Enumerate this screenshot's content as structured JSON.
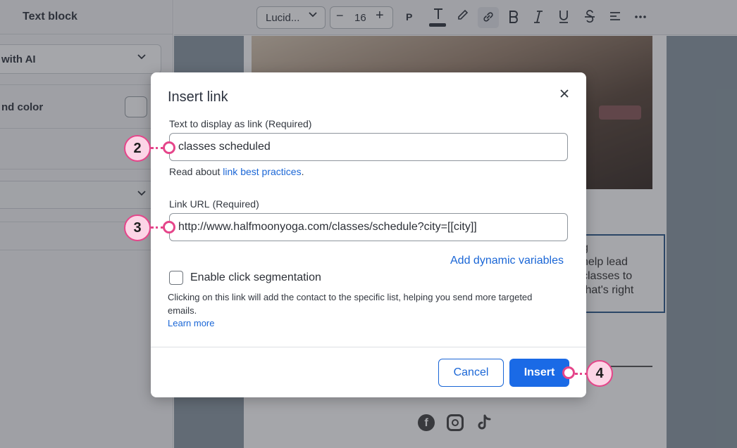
{
  "left_panel": {
    "title": "Text block",
    "ai_item": "with AI",
    "background_color_label": "nd color"
  },
  "toolbar": {
    "font_family": "Lucid...",
    "font_size": "16",
    "paragraph_label": "P"
  },
  "canvas": {
    "paragraph": "g\nhelp lead\nclasses to\nthat's right"
  },
  "modal": {
    "title": "Insert link",
    "display_text": {
      "label": "Text to display as link",
      "required": "(Required)",
      "value": "classes scheduled"
    },
    "help": {
      "prefix": "Read about ",
      "link": "link best practices",
      "suffix": "."
    },
    "url": {
      "label": "Link URL",
      "required": "(Required)",
      "value": "http://www.halfmoonyoga.com/classes/schedule?city=[[city]]"
    },
    "dynamic_variables_link": "Add dynamic variables",
    "segmentation": {
      "label": "Enable click segmentation",
      "checked": false,
      "description": "Clicking on this link will add the contact to the specific list, helping you send more targeted emails.",
      "learn_more": "Learn more"
    },
    "buttons": {
      "cancel": "Cancel",
      "insert": "Insert"
    }
  },
  "callouts": {
    "step_2": "2",
    "step_3": "3",
    "step_4": "4"
  },
  "colors": {
    "primary": "#1a6ae6",
    "callout": "#e5458a"
  }
}
